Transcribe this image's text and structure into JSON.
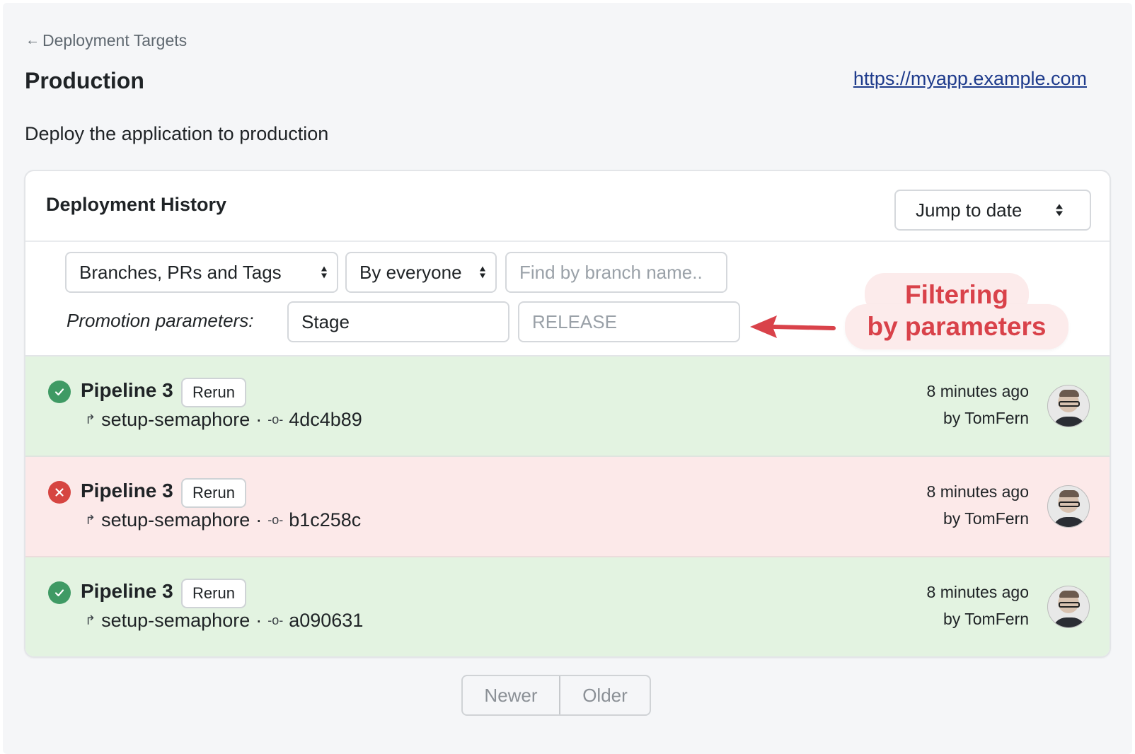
{
  "breadcrumb": {
    "back_icon": "arrow-left-icon",
    "label": "Deployment Targets"
  },
  "page": {
    "title": "Production",
    "url": "https://myapp.example.com",
    "description": "Deploy the application to production"
  },
  "history": {
    "title": "Deployment History",
    "jump_to_date": "Jump to date",
    "filters": {
      "type_select": "Branches, PRs and Tags",
      "people_select": "By everyone",
      "branch_search_placeholder": "Find by branch name..",
      "promotion_label": "Promotion parameters:",
      "param1_value": "Stage",
      "param2_placeholder": "RELEASE"
    },
    "annotation": {
      "line1": "Filtering",
      "line2": "by parameters"
    },
    "rows": [
      {
        "status": "passed",
        "status_icon": "check-circle-icon",
        "name": "Pipeline 3",
        "rerun": "Rerun",
        "branch": "setup-semaphore",
        "separator": "·",
        "commit": "4dc4b89",
        "time": "8 minutes ago",
        "author": "by TomFern"
      },
      {
        "status": "failed",
        "status_icon": "x-circle-icon",
        "name": "Pipeline 3",
        "rerun": "Rerun",
        "branch": "setup-semaphore",
        "separator": "·",
        "commit": "b1c258c",
        "time": "8 minutes ago",
        "author": "by TomFern"
      },
      {
        "status": "passed",
        "status_icon": "check-circle-icon",
        "name": "Pipeline 3",
        "rerun": "Rerun",
        "branch": "setup-semaphore",
        "separator": "·",
        "commit": "a090631",
        "time": "8 minutes ago",
        "author": "by TomFern"
      }
    ]
  },
  "pagination": {
    "newer": "Newer",
    "older": "Older"
  },
  "colors": {
    "passed_bg": "#e3f3e1",
    "failed_bg": "#fce9e9",
    "passed_icon": "#3f9a64",
    "failed_icon": "#d64541",
    "annotation": "#d9424a",
    "link": "#1e3b8c"
  }
}
